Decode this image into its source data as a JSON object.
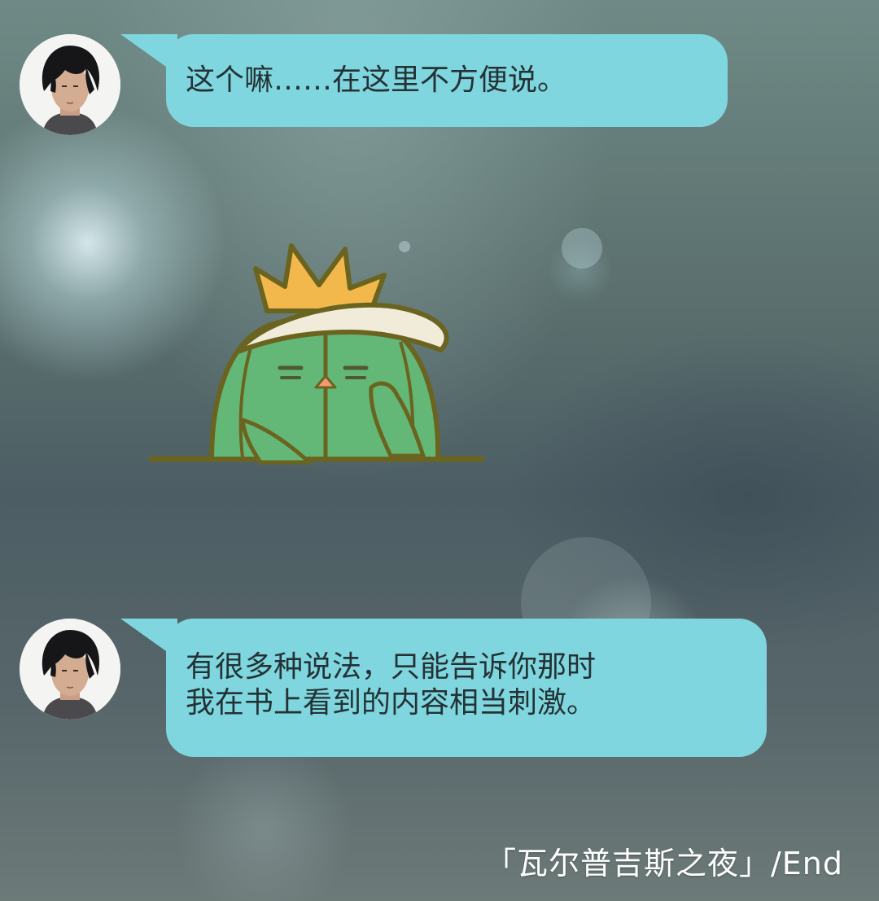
{
  "messages": [
    {
      "sender": "avatar",
      "text": "这个嘛……在这里不方便说。"
    },
    {
      "sender": "avatar",
      "text": "有很多种说法，只能告诉你那时\n我在书上看到的内容相当刺激。"
    }
  ],
  "sticker": {
    "icon": "cactus-sticker",
    "colors": {
      "body": "#64b877",
      "outline": "#6b6420",
      "crown": "#f2b84c",
      "cap": "#f1ecd9",
      "beak": "#f39a72"
    }
  },
  "footer": {
    "end_label": "「瓦尔普吉斯之夜」/End"
  },
  "colors": {
    "bubble": "#7fd6de",
    "bubble_text": "#243235",
    "footer_text": "#ffffff"
  }
}
